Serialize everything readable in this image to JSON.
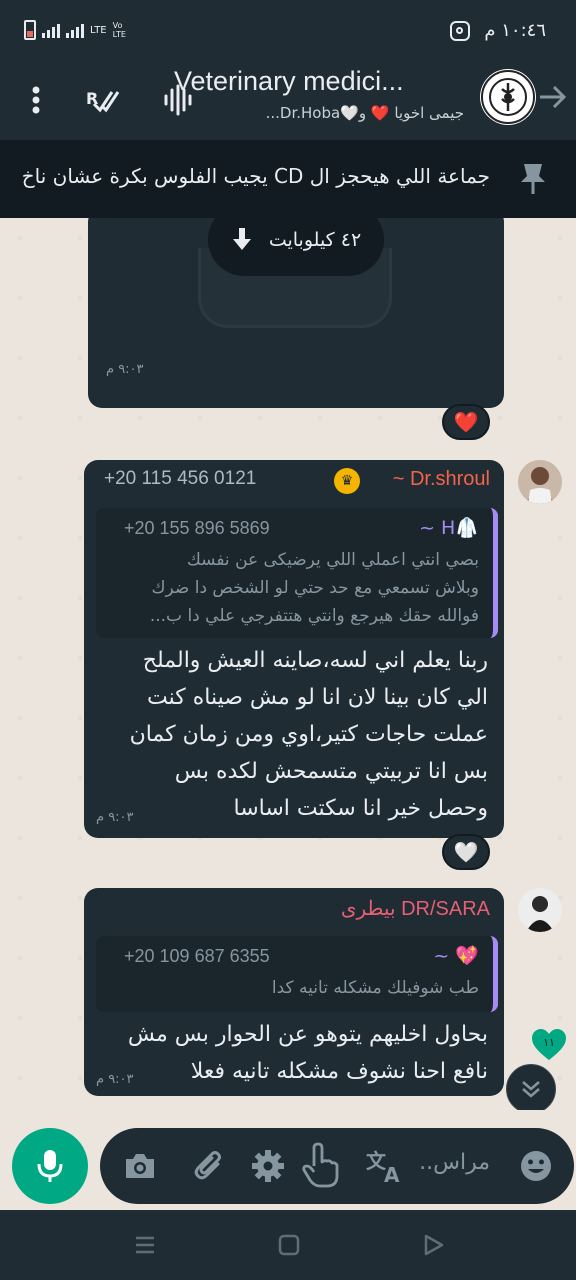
{
  "status_bar": {
    "time": "١٠:٤٦ م",
    "network": "LTE",
    "volte": "Vo LTE"
  },
  "header": {
    "title": "Veterinary medici...",
    "subtitle": "جيمى اخويا ❤️ و🤍Dr.Hoba..."
  },
  "pinned": {
    "text": "جماعة اللي هيحجز ال CD يجيب الفلوس بكرة عشان ناخ..."
  },
  "messages": [
    {
      "type": "document",
      "download_label": "٤٢ كيلوبايت",
      "time": "٩:٠٣ م",
      "reaction": "❤️"
    },
    {
      "sender_name": "~ Dr.shroul",
      "sender_phone": "+20 115 456 0121",
      "quote": {
        "name": "~ H🥼",
        "phone": "+20 155 896 5869",
        "lines": [
          "بصي انتي اعملي اللي يرضيكى عن نفسك",
          "وبلاش تسمعي مع حد حتي لو الشخص دا ضرك",
          "فوالله حقك هيرجع وانتي هتتفرجي علي دا ب..."
        ]
      },
      "lines": [
        "ربنا يعلم اني لسه،صاينه العيش والملح",
        "الي كان بينا لان انا لو مش صيناه كنت",
        "عملت حاجات كتير،اوي ومن زمان كمان",
        "بس انا تربيتي متسمحش لكده بس",
        "وحصل خير انا سكتت اساسا"
      ],
      "time": "٩:٠٣ م",
      "reaction": "🤍"
    },
    {
      "sender_name": "بيطرى DR/SARA",
      "quote": {
        "name": "~ 💖",
        "phone": "+20 109 687 6355",
        "lines": [
          "طب شوفيلك مشكله تانيه كدا"
        ]
      },
      "lines": [
        "بحاول اخليهم يتوهو عن الحوار بس مش",
        "نافع احنا نشوف مشكله تانيه فعلا"
      ],
      "time": "٩:٠٣ م"
    }
  ],
  "unread_count": "١١",
  "input": {
    "placeholder": "مراس.."
  },
  "colors": {
    "accent": "#00a884",
    "sender1": "#f5634a",
    "sender2": "#e85f73",
    "quote_bar": "#a68bf5"
  }
}
